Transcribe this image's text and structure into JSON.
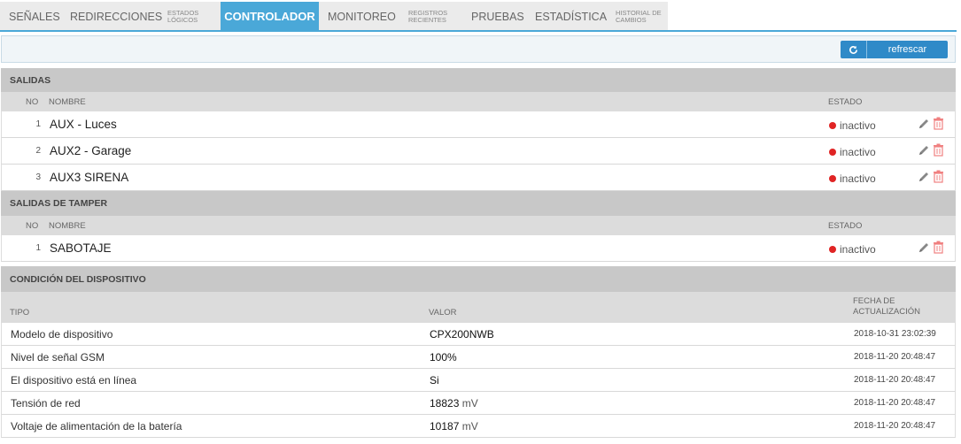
{
  "tabs": [
    {
      "label": "SEÑALES"
    },
    {
      "label": "REDIRECCIONES"
    },
    {
      "label": "ESTADOS LÓGICOS"
    },
    {
      "label": "CONTROLADOR",
      "active": true
    },
    {
      "label": "MONITOREO"
    },
    {
      "label": "REGISTROS RECIENTES"
    },
    {
      "label": "PRUEBAS"
    },
    {
      "label": "ESTADÍSTICA"
    },
    {
      "label": "HISTORIAL DE CAMBIOS"
    }
  ],
  "toolbar": {
    "refresh_label": "refrescar",
    "refresh_icon": "refresh-icon"
  },
  "colors": {
    "accent": "#4aa8d8",
    "button": "#2f8ac8",
    "inactive_dot": "#e02424"
  },
  "outputs": {
    "title": "SALIDAS",
    "headers": {
      "no": "NO",
      "name": "NOMBRE",
      "state": "ESTADO"
    },
    "rows": [
      {
        "no": "1",
        "name": "AUX - Luces",
        "state": "inactivo"
      },
      {
        "no": "2",
        "name": "AUX2 - Garage",
        "state": "inactivo"
      },
      {
        "no": "3",
        "name": "AUX3 SIRENA",
        "state": "inactivo"
      }
    ]
  },
  "tamper": {
    "title": "SALIDAS DE TAMPER",
    "headers": {
      "no": "NO",
      "name": "NOMBRE",
      "state": "ESTADO"
    },
    "rows": [
      {
        "no": "1",
        "name": "SABOTAJE",
        "state": "inactivo"
      }
    ]
  },
  "device": {
    "title": "CONDICIÓN DEL DISPOSITIVO",
    "headers": {
      "type": "TIPO",
      "value": "VALOR",
      "date_line1": "FECHA DE",
      "date_line2": "ACTUALIZACIÓN"
    },
    "rows": [
      {
        "type": "Modelo de dispositivo",
        "value": "CPX200NWB",
        "unit": "",
        "date": "2018-10-31 23:02:39"
      },
      {
        "type": "Nivel de señal GSM",
        "value": "100%",
        "unit": "",
        "date": "2018-11-20 20:48:47"
      },
      {
        "type": "El dispositivo está en línea",
        "value": "Si",
        "unit": "",
        "date": "2018-11-20 20:48:47"
      },
      {
        "type": "Tensión de red",
        "value": "18823",
        "unit": " mV",
        "date": "2018-11-20 20:48:47"
      },
      {
        "type": "Voltaje de alimentación de la batería",
        "value": "10187",
        "unit": " mV",
        "date": "2018-11-20 20:48:47"
      }
    ]
  }
}
